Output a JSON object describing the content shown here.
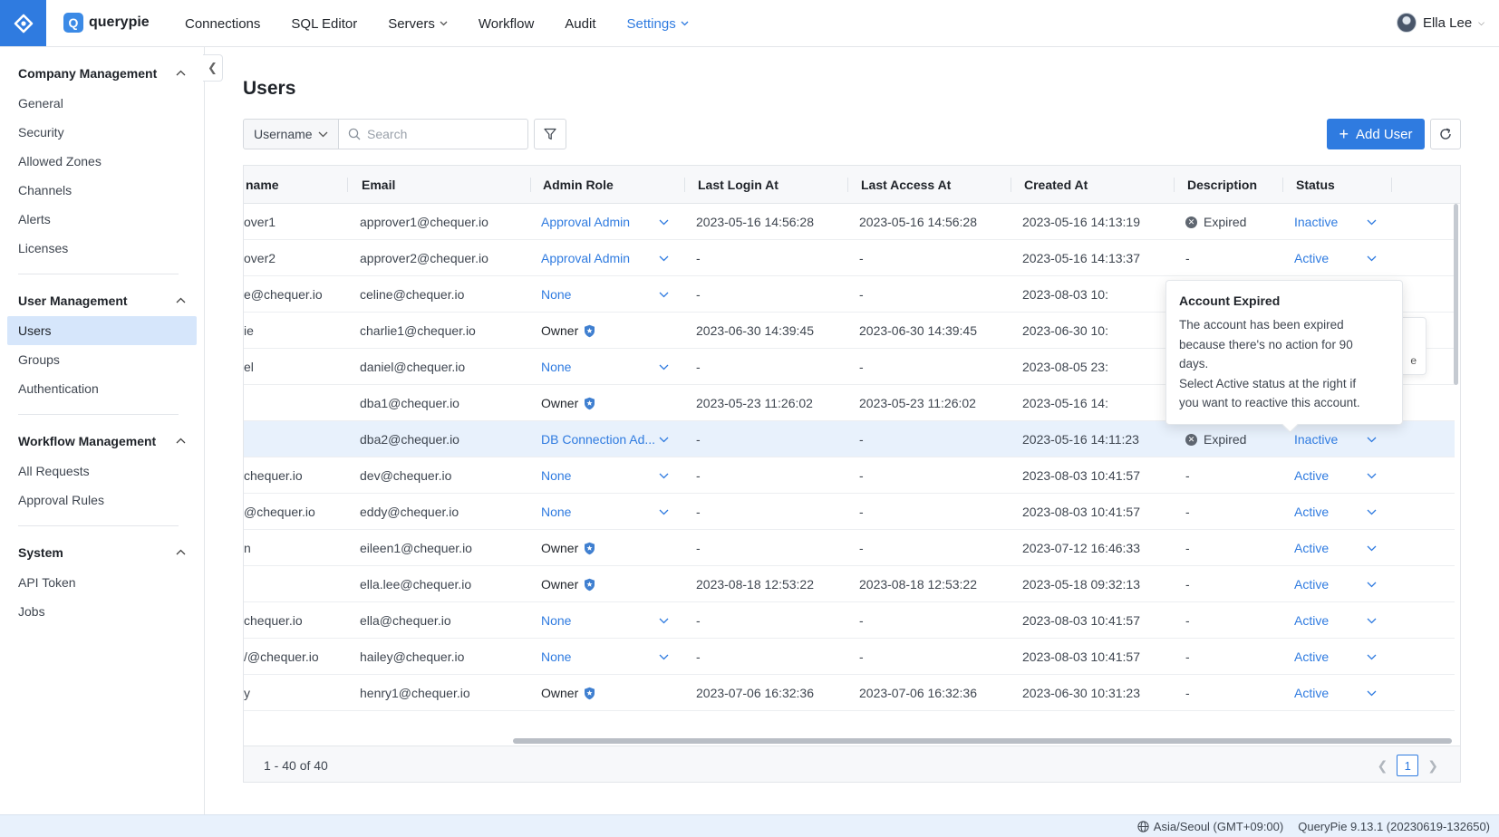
{
  "app": {
    "name": "querypie",
    "logo_letter": "Q",
    "accent": "#2f7be0"
  },
  "nav": [
    {
      "label": "Connections",
      "has_caret": false,
      "active": false
    },
    {
      "label": "SQL Editor",
      "has_caret": false,
      "active": false
    },
    {
      "label": "Servers",
      "has_caret": true,
      "active": false
    },
    {
      "label": "Workflow",
      "has_caret": false,
      "active": false
    },
    {
      "label": "Audit",
      "has_caret": false,
      "active": false
    },
    {
      "label": "Settings",
      "has_caret": true,
      "active": true
    }
  ],
  "user": {
    "name": "Ella Lee"
  },
  "sidebar": {
    "sections": [
      {
        "title": "Company Management",
        "items": [
          "General",
          "Security",
          "Allowed Zones",
          "Channels",
          "Alerts",
          "Licenses"
        ],
        "active": -1
      },
      {
        "title": "User Management",
        "items": [
          "Users",
          "Groups",
          "Authentication"
        ],
        "active": 0
      },
      {
        "title": "Workflow Management",
        "items": [
          "All Requests",
          "Approval Rules"
        ],
        "active": -1
      },
      {
        "title": "System",
        "items": [
          "API Token",
          "Jobs"
        ],
        "active": -1
      }
    ]
  },
  "page": {
    "title": "Users"
  },
  "toolbar": {
    "field_select": "Username",
    "search_placeholder": "Search",
    "add_user_label": "Add User"
  },
  "table": {
    "columns": [
      "name",
      "Email",
      "Admin Role",
      "Last Login At",
      "Last Access At",
      "Created At",
      "Description",
      "Status"
    ],
    "rows": [
      {
        "name": "over1",
        "email": "approver1@chequer.io",
        "role": "Approval Admin",
        "role_type": "link",
        "login": "2023-05-16 14:56:28",
        "access": "2023-05-16 14:56:28",
        "created": "2023-05-16 14:13:19",
        "desc": "Expired",
        "status": "Inactive",
        "highlight": false
      },
      {
        "name": "over2",
        "email": "approver2@chequer.io",
        "role": "Approval Admin",
        "role_type": "link",
        "login": "-",
        "access": "-",
        "created": "2023-05-16 14:13:37",
        "desc": "-",
        "status": "Active",
        "highlight": false
      },
      {
        "name": "e@chequer.io",
        "email": "celine@chequer.io",
        "role": "None",
        "role_type": "link",
        "login": "-",
        "access": "-",
        "created": "2023-08-03 10:",
        "desc": "",
        "status": "",
        "highlight": false
      },
      {
        "name": "ie",
        "email": "charlie1@chequer.io",
        "role": "Owner",
        "role_type": "owner",
        "login": "2023-06-30 14:39:45",
        "access": "2023-06-30 14:39:45",
        "created": "2023-06-30 10:",
        "desc": "",
        "status": "",
        "highlight": false
      },
      {
        "name": "el",
        "email": "daniel@chequer.io",
        "role": "None",
        "role_type": "link",
        "login": "-",
        "access": "-",
        "created": "2023-08-05 23:",
        "desc": "",
        "status": "",
        "highlight": false
      },
      {
        "name": "",
        "email": "dba1@chequer.io",
        "role": "Owner",
        "role_type": "owner",
        "login": "2023-05-23 11:26:02",
        "access": "2023-05-23 11:26:02",
        "created": "2023-05-16 14:",
        "desc": "",
        "status": "",
        "highlight": false
      },
      {
        "name": "",
        "email": "dba2@chequer.io",
        "role": "DB Connection Ad...",
        "role_type": "link",
        "login": "-",
        "access": "-",
        "created": "2023-05-16 14:11:23",
        "desc": "Expired",
        "status": "Inactive",
        "highlight": true
      },
      {
        "name": "chequer.io",
        "email": "dev@chequer.io",
        "role": "None",
        "role_type": "link",
        "login": "-",
        "access": "-",
        "created": "2023-08-03 10:41:57",
        "desc": "-",
        "status": "Active",
        "highlight": false
      },
      {
        "name": "@chequer.io",
        "email": "eddy@chequer.io",
        "role": "None",
        "role_type": "link",
        "login": "-",
        "access": "-",
        "created": "2023-08-03 10:41:57",
        "desc": "-",
        "status": "Active",
        "highlight": false
      },
      {
        "name": "n",
        "email": "eileen1@chequer.io",
        "role": "Owner",
        "role_type": "owner",
        "login": "-",
        "access": "-",
        "created": "2023-07-12 16:46:33",
        "desc": "-",
        "status": "Active",
        "highlight": false
      },
      {
        "name": "",
        "email": "ella.lee@chequer.io",
        "role": "Owner",
        "role_type": "owner",
        "login": "2023-08-18 12:53:22",
        "access": "2023-08-18 12:53:22",
        "created": "2023-05-18 09:32:13",
        "desc": "-",
        "status": "Active",
        "highlight": false
      },
      {
        "name": "chequer.io",
        "email": "ella@chequer.io",
        "role": "None",
        "role_type": "link",
        "login": "-",
        "access": "-",
        "created": "2023-08-03 10:41:57",
        "desc": "-",
        "status": "Active",
        "highlight": false
      },
      {
        "name": "/@chequer.io",
        "email": "hailey@chequer.io",
        "role": "None",
        "role_type": "link",
        "login": "-",
        "access": "-",
        "created": "2023-08-03 10:41:57",
        "desc": "-",
        "status": "Active",
        "highlight": false
      },
      {
        "name": "y",
        "email": "henry1@chequer.io",
        "role": "Owner",
        "role_type": "owner",
        "login": "2023-07-06 16:32:36",
        "access": "2023-07-06 16:32:36",
        "created": "2023-06-30 10:31:23",
        "desc": "-",
        "status": "Active",
        "highlight": false
      }
    ],
    "count_label": "1 - 40 of 40",
    "page": "1"
  },
  "tooltip": {
    "title": "Account Expired",
    "lines": [
      "The account has been expired",
      "because there's no action for 90",
      "days.",
      "Select Active status at the right if",
      "you want to reactive this account."
    ],
    "behind_text": "e"
  },
  "footer": {
    "timezone": "Asia/Seoul (GMT+09:00)",
    "version": "QueryPie 9.13.1 (20230619-132650)"
  }
}
